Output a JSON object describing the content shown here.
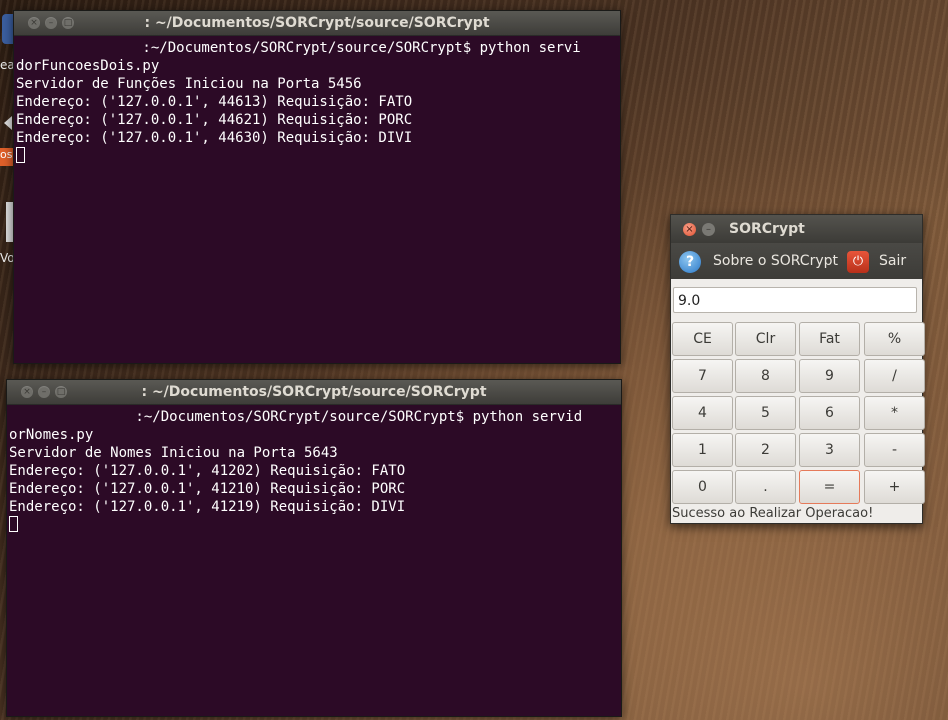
{
  "desktop": {
    "frag_text_1": "ea",
    "frag_text_2": "Vo",
    "frag_text_3": "os"
  },
  "terminal1": {
    "title": ": ~/Documentos/SORCrypt/source/SORCrypt",
    "lines": [
      "               :~/Documentos/SORCrypt/source/SORCrypt$ python servi",
      "dorFuncoesDois.py",
      "Servidor de Funções Iniciou na Porta 5456",
      "Endereço: ('127.0.0.1', 44613) Requisição: FATO",
      "Endereço: ('127.0.0.1', 44621) Requisição: PORC",
      "Endereço: ('127.0.0.1', 44630) Requisição: DIVI"
    ]
  },
  "terminal2": {
    "title": ": ~/Documentos/SORCrypt/source/SORCrypt",
    "lines": [
      "               :~/Documentos/SORCrypt/source/SORCrypt$ python servid",
      "orNomes.py",
      "Servidor de Nomes Iniciou na Porta 5643",
      "Endereço: ('127.0.0.1', 41202) Requisição: FATO",
      "Endereço: ('127.0.0.1', 41210) Requisição: PORC",
      "Endereço: ('127.0.0.1', 41219) Requisição: DIVI"
    ]
  },
  "calculator": {
    "title": "SORCrypt",
    "menu_about": "Sobre o SORCrypt",
    "menu_exit": "Sair",
    "display_value": "9.0",
    "keys": [
      [
        "CE",
        "Clr",
        "Fat",
        "%"
      ],
      [
        "7",
        "8",
        "9",
        "/"
      ],
      [
        "4",
        "5",
        "6",
        "*"
      ],
      [
        "1",
        "2",
        "3",
        "-"
      ],
      [
        "0",
        ".",
        "=",
        "+"
      ]
    ],
    "status": "Sucesso ao Realizar Operacao!"
  }
}
